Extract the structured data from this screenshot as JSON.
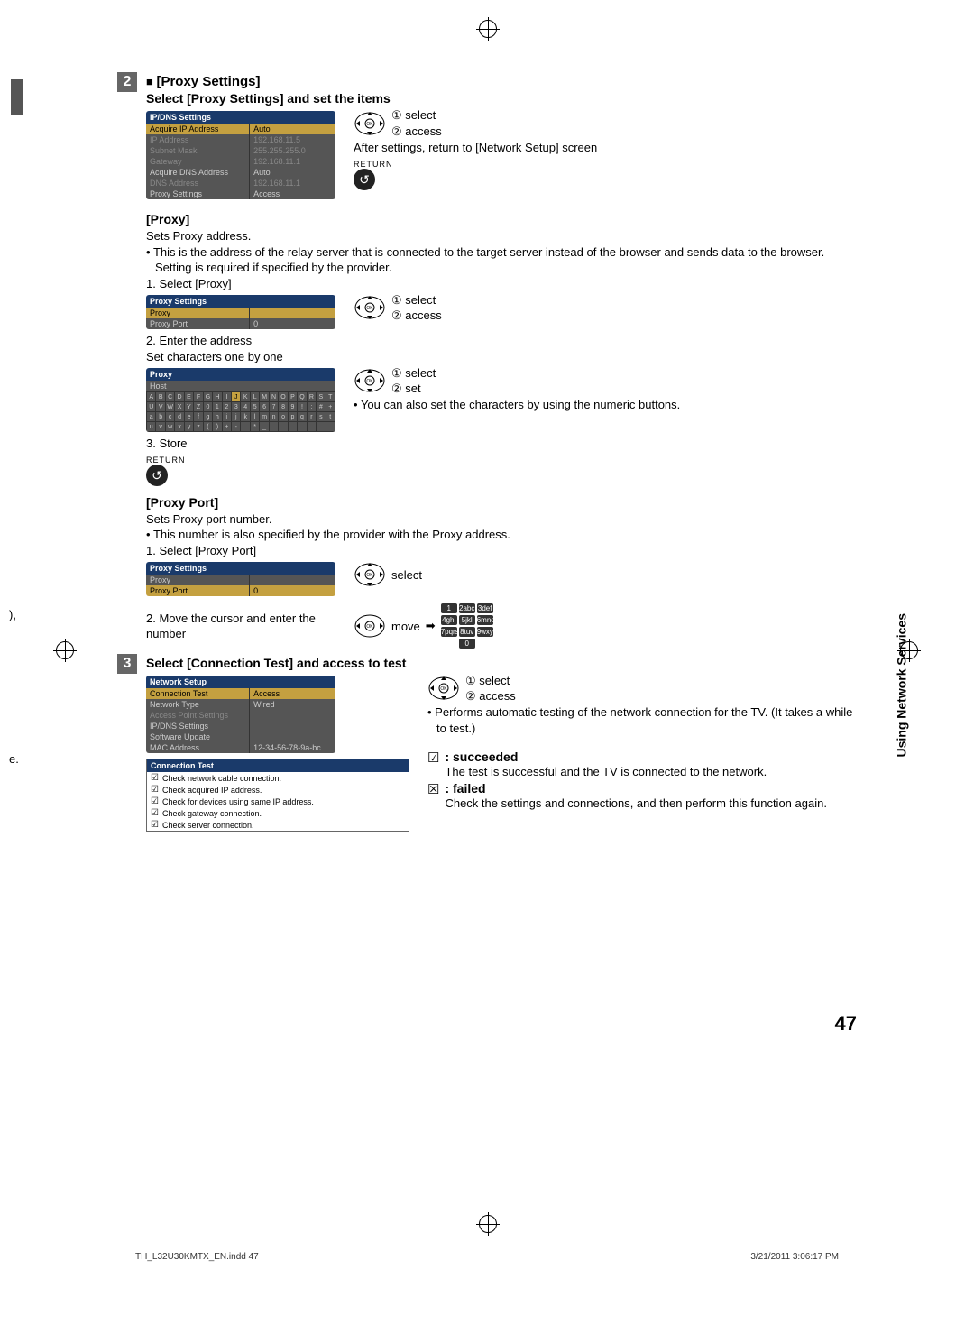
{
  "sidebar": "Using Network Services",
  "page_number": "47",
  "footer_left": "TH_L32U30KMTX_EN.indd   47",
  "footer_right": "3/21/2011   3:06:17 PM",
  "hidden": {
    "l1": "),",
    "l2": "e."
  },
  "steps": {
    "s2": {
      "num": "2",
      "title": "[Proxy Settings]",
      "subtitle": "Select [Proxy Settings] and set the items",
      "after": "After settings, return to [Network Setup] screen",
      "return_label": "RETURN",
      "dpad1": {
        "a": "① select",
        "b": "② access"
      },
      "menu": {
        "title": "IP/DNS Settings",
        "rows": [
          {
            "l": "Acquire IP Address",
            "r": "Auto",
            "cls": "sel"
          },
          {
            "l": "IP Address",
            "r": "192.168.11.5",
            "cls": "d"
          },
          {
            "l": "Subnet Mask",
            "r": "255.255.255.0",
            "cls": "d"
          },
          {
            "l": "Gateway",
            "r": "192.168.11.1",
            "cls": "d"
          },
          {
            "l": "Acquire DNS Address",
            "r": "Auto",
            "cls": ""
          },
          {
            "l": "DNS Address",
            "r": "192.168.11.1",
            "cls": "d"
          },
          {
            "l": "Proxy Settings",
            "r": "Access",
            "cls": ""
          }
        ]
      },
      "proxy": {
        "h": "[Proxy]",
        "t1": "Sets Proxy address.",
        "t2": "This is the address of the relay server that is connected to the target server instead of the browser and sends data to the browser. Setting is required if specified by the provider.",
        "st1": "1. Select [Proxy]",
        "dpad": {
          "a": "① select",
          "b": "② access"
        },
        "menu": {
          "title": "Proxy Settings",
          "rows": [
            {
              "l": "Proxy",
              "r": "",
              "cls": "sel"
            },
            {
              "l": "Proxy Port",
              "r": "0",
              "cls": ""
            }
          ]
        },
        "st2": "2. Enter the address",
        "st2b": "Set characters one by one",
        "dpad2": {
          "a": "① select",
          "b": "② set"
        },
        "note": "You can also set the characters by using the numeric buttons.",
        "host_title": "Proxy",
        "host_sub": "Host",
        "st3": "3. Store",
        "return_label": "RETURN"
      },
      "port": {
        "h": "[Proxy Port]",
        "t1": "Sets Proxy port number.",
        "t2": "This number is also specified by the provider with the Proxy address.",
        "st1": "1. Select [Proxy Port]",
        "dpad_label": "select",
        "menu": {
          "title": "Proxy Settings",
          "rows": [
            {
              "l": "Proxy",
              "r": "",
              "cls": ""
            },
            {
              "l": "Proxy Port",
              "r": "0",
              "cls": "sel"
            }
          ]
        },
        "st2": "2. Move the cursor and enter the number",
        "move_label": "move",
        "numkeys": [
          "1",
          "2abc",
          "3def",
          "4ghi",
          "5jkl",
          "6mno",
          "7pqrs",
          "8tuv",
          "9wxyz",
          "",
          "0",
          ""
        ]
      }
    },
    "s3": {
      "num": "3",
      "title": "Select [Connection Test] and access to test",
      "dpad": {
        "a": "① select",
        "b": "② access"
      },
      "note": "Performs automatic testing of the network connection for the TV. (It takes a while to test.)",
      "menu": {
        "title": "Network Setup",
        "rows": [
          {
            "l": "Connection Test",
            "r": "Access",
            "cls": "sel"
          },
          {
            "l": "Network Type",
            "r": "Wired",
            "cls": ""
          },
          {
            "l": "Access Point Settings",
            "r": "",
            "cls": "d"
          },
          {
            "l": "IP/DNS Settings",
            "r": "",
            "cls": ""
          },
          {
            "l": "Software Update",
            "r": "",
            "cls": ""
          },
          {
            "l": "MAC Address",
            "r": "12-34-56-78-9a-bc",
            "cls": ""
          }
        ]
      },
      "ct": {
        "title": "Connection Test",
        "items": [
          "Check network cable connection.",
          "Check acquired IP address.",
          "Check for devices using same IP address.",
          "Check gateway connection.",
          "Check server connection."
        ]
      },
      "succ": {
        "h": ": succeeded",
        "t": "The test is successful and the TV is connected to the network."
      },
      "fail": {
        "h": ": failed",
        "t": "Check the settings and connections, and then perform this function again."
      }
    }
  }
}
